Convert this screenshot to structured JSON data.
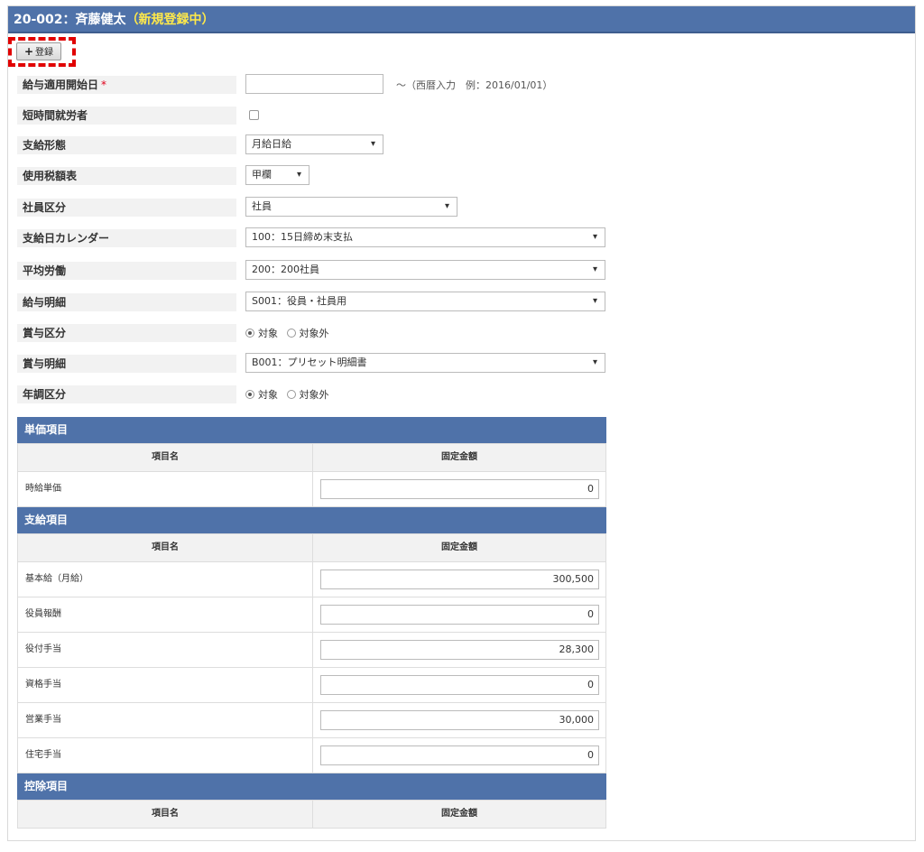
{
  "header": {
    "title": "20-002：斉藤健太",
    "status": "（新規登録中）"
  },
  "toolbar": {
    "register_plus": "+",
    "register_label": "登録"
  },
  "form": {
    "start_date": {
      "label": "給与適用開始日",
      "required_mark": "*",
      "value": "",
      "hint": "～（西暦入力　例：2016/01/01）"
    },
    "short_time_worker": {
      "label": "短時間就労者",
      "checked": false
    },
    "payment_type": {
      "label": "支給形態",
      "value": "月給日給"
    },
    "tax_table": {
      "label": "使用税額表",
      "value": "甲欄"
    },
    "employee_class": {
      "label": "社員区分",
      "value": "社員"
    },
    "pay_calendar": {
      "label": "支給日カレンダー",
      "value": "100：15日締め末支払"
    },
    "average_labor": {
      "label": "平均労働",
      "value": "200：200社員"
    },
    "pay_statement": {
      "label": "給与明細",
      "value": "S001：役員・社員用"
    },
    "bonus_class": {
      "label": "賞与区分",
      "opt_on": "対象",
      "opt_off": "対象外",
      "selected": "対象"
    },
    "bonus_statement": {
      "label": "賞与明細",
      "value": "B001：プリセット明細書"
    },
    "year_end_class": {
      "label": "年調区分",
      "opt_on": "対象",
      "opt_off": "対象外",
      "selected": "対象"
    }
  },
  "tables": {
    "col_name": "項目名",
    "col_amount": "固定金額",
    "unit_price": {
      "title": "単価項目",
      "rows": [
        {
          "name": "時給単価",
          "value": "0"
        }
      ]
    },
    "payments": {
      "title": "支給項目",
      "rows": [
        {
          "name": "基本給（月給）",
          "value": "300,500"
        },
        {
          "name": "役員報酬",
          "value": "0"
        },
        {
          "name": "役付手当",
          "value": "28,300"
        },
        {
          "name": "資格手当",
          "value": "0"
        },
        {
          "name": "営業手当",
          "value": "30,000"
        },
        {
          "name": "住宅手当",
          "value": "0"
        }
      ]
    },
    "deductions": {
      "title": "控除項目"
    }
  },
  "colors": {
    "header_bg": "#4f72a9",
    "status_text": "#ffe94a",
    "highlight_border": "#e10000"
  }
}
